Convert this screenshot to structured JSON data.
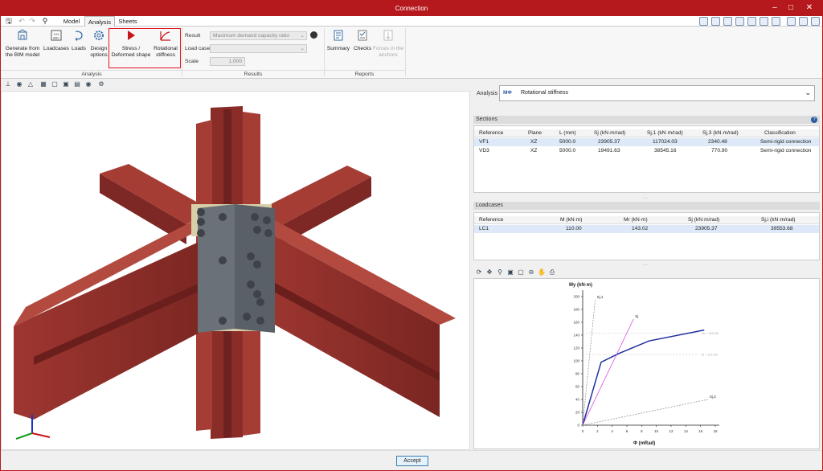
{
  "window": {
    "title": "Connection"
  },
  "tabs": [
    {
      "label": "Model"
    },
    {
      "label": "Analysis"
    },
    {
      "label": "Sheets"
    }
  ],
  "ribbon": {
    "analysis_buttons": [
      {
        "label": "Generate from the BIM model"
      },
      {
        "label": "Loadcases"
      },
      {
        "label": "Loads"
      },
      {
        "label": "Design options"
      },
      {
        "label": "Stress / Deformed shape"
      },
      {
        "label": "Rotational stiffness"
      }
    ],
    "analysis_group": "Analysis",
    "results": {
      "result_label": "Result",
      "result_value": "Maximum demand capacity ratio",
      "loadcase_label": "Load case",
      "loadcase_value": "",
      "scale_label": "Scale",
      "scale_value": "1.000",
      "group": "Results"
    },
    "reports_buttons": [
      {
        "label": "Summary"
      },
      {
        "label": "Checks"
      },
      {
        "label": "Forces in the anchors"
      }
    ],
    "reports_group": "Reports",
    "highlight_color": "#e0141e"
  },
  "analysis_select": {
    "label": "Analysis",
    "icon_text": "MΦ",
    "value": "Rotational stiffness"
  },
  "sections": {
    "title": "Sections",
    "columns": [
      "Reference",
      "Plane",
      "L (mm)",
      "Sj (kN·m/rad)",
      "Sj,1 (kN·m/rad)",
      "Sj,3 (kN·m/rad)",
      "Classification"
    ],
    "rows": [
      [
        "VF1",
        "XZ",
        "5000.0",
        "23905.37",
        "117024.03",
        "2340.48",
        "Semi-rigid connection"
      ],
      [
        "VD3",
        "XZ",
        "5000.0",
        "19491.63",
        "38545.16",
        "770.90",
        "Semi-rigid connection"
      ]
    ]
  },
  "loadcases": {
    "title": "Loadcases",
    "columns": [
      "Reference",
      "M (kN·m)",
      "Mr (kN·m)",
      "Sj (kN·m/rad)",
      "Sj,i (kN·m/rad)"
    ],
    "rows": [
      [
        "LC1",
        "110.00",
        "143.02",
        "23905.37",
        "39553.68"
      ]
    ]
  },
  "chart_data": {
    "type": "line",
    "ylabel": "My (kN·m)",
    "xlabel": "Φ (mRad)",
    "xlim": [
      0,
      18
    ],
    "ylim": [
      0,
      200
    ],
    "xticks": [
      0,
      2,
      4,
      6,
      8,
      10,
      12,
      14,
      16,
      18
    ],
    "yticks": [
      0,
      20,
      40,
      60,
      80,
      100,
      120,
      140,
      160,
      180,
      200
    ],
    "series": [
      {
        "name": "",
        "color": "#1f2f9f",
        "x": [
          0,
          2.5,
          5,
          9,
          16.5
        ],
        "y": [
          0,
          98,
          112,
          131,
          148
        ]
      },
      {
        "name": "Sj,1",
        "color": "#8a8a8a",
        "x": [
          0,
          1.7
        ],
        "y": [
          0,
          195
        ]
      },
      {
        "name": "Sj",
        "color": "#d837d8",
        "x": [
          0,
          6.9
        ],
        "y": [
          0,
          165
        ]
      },
      {
        "name": "Sj,3",
        "color": "#8a8a8a",
        "x": [
          0,
          17
        ],
        "y": [
          0,
          40
        ]
      }
    ],
    "hlines": [
      {
        "y": 143.02,
        "label": "Mr = 143.020"
      },
      {
        "y": 110,
        "label": "M = 110.000"
      }
    ],
    "grid": false
  },
  "footer": {
    "accept_label": "Accept"
  }
}
